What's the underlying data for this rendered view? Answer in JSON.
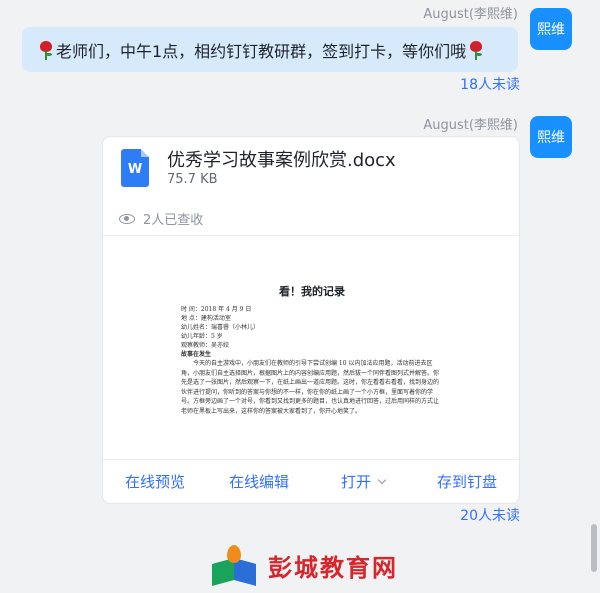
{
  "messages": [
    {
      "sender": "August(李熙维)",
      "avatar_text": "熙维",
      "text": "老师们，中午1点，相约钉钉教研群，签到打卡，等你们哦",
      "unread": "18人未读"
    },
    {
      "sender": "August(李熙维)",
      "avatar_text": "熙维",
      "file": {
        "icon_letter": "W",
        "name": "优秀学习故事案例欣赏.docx",
        "size": "75.7 KB",
        "views": "2人已查收",
        "preview": {
          "title": "看！我的记录",
          "lines": [
            "时  间：2018 年 4 月 9 日",
            "地  点：建构活动室",
            "幼儿姓名：瑞喜睿（小林儿）",
            "幼儿年龄：5 岁",
            "观察教师：吴亦姣"
          ],
          "heading": "故事在发生",
          "paragraph": "今天的自主游戏中，小朋友们在教师的引导下尝试创编 10 以内加法应用题，活动前进去区角，小朋友们自主选择图片，根据图片上的内容创编应用题，然后拔一个同伴看图列式并解答。你先是选了一张图片，然后观察一下，在纸上画出一道应用题。这时，你左看看右看看，找到身边的伙伴进行提问，你听到的答案与你想的不一样，你在你的纸上画了一个小方框，里面写着你的学号。方框旁边画了一个对号，你看到又找到更多的题目，也认真地进行回答，过后用同样的方式让老师在黑板上写出来，这样你的答案被大家看到了，你开心地笑了。"
        },
        "actions": [
          "在线预览",
          "在线编辑",
          "打开",
          "存到钉盘"
        ]
      },
      "unread": "20人未读"
    }
  ],
  "watermark": {
    "brand": "彭城教育网"
  },
  "colors": {
    "accent": "#3370ff",
    "avatar": "#1890ff",
    "bubble": "#d6eafc",
    "background": "#f1f2f4"
  }
}
